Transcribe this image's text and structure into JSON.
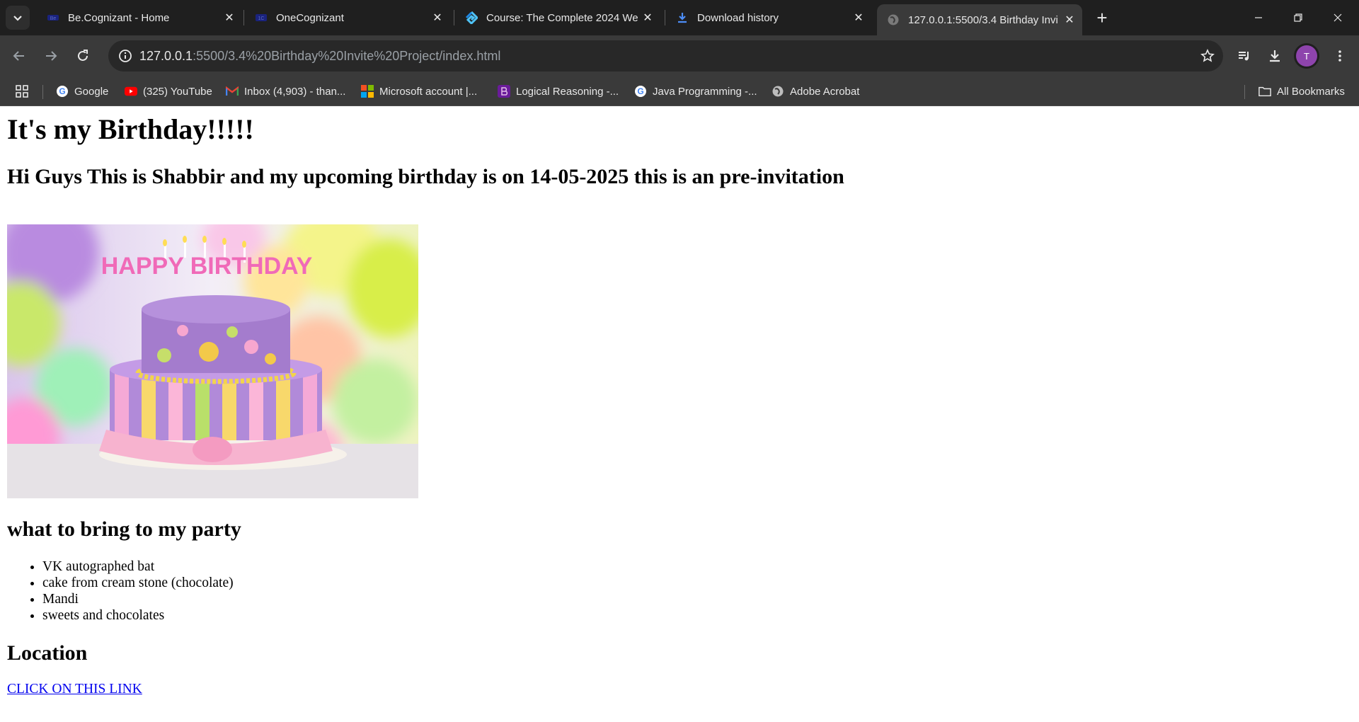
{
  "browser": {
    "tabs": [
      {
        "title": "Be.Cognizant - Home",
        "icon": "cognizant-favicon"
      },
      {
        "title": "OneCognizant",
        "icon": "onecognizant-favicon"
      },
      {
        "title": "Course: The Complete 2024 We",
        "icon": "udemy-favicon"
      },
      {
        "title": "Download history",
        "icon": "download-icon"
      },
      {
        "title": "127.0.0.1:5500/3.4 Birthday Invi",
        "icon": "globe-icon",
        "active": true
      }
    ],
    "address": {
      "host": "127.0.0.1",
      "path": ":5500/3.4%20Birthday%20Invite%20Project/index.html"
    },
    "profile_initial": "T",
    "bookmarks": [
      {
        "label": "Google",
        "icon": "google-icon"
      },
      {
        "label": "(325) YouTube",
        "icon": "youtube-icon"
      },
      {
        "label": "Inbox (4,903) - than...",
        "icon": "gmail-icon"
      },
      {
        "label": "Microsoft account |...",
        "icon": "microsoft-icon"
      },
      {
        "label": "Logical Reasoning -...",
        "icon": "bookmark-app-icon"
      },
      {
        "label": "Java Programming -...",
        "icon": "google-icon"
      },
      {
        "label": "Adobe Acrobat",
        "icon": "globe-icon"
      }
    ],
    "all_bookmarks_label": "All Bookmarks"
  },
  "page": {
    "heading": "It's my Birthday!!!!!",
    "subheading": "Hi Guys This is Shabbir and my upcoming birthday is on 14-05-2025 this is an pre-invitation",
    "image_text": "HAPPY BIRTHDAY",
    "bring_heading": "what to bring to my party",
    "bring_items": [
      "VK autographed bat",
      "cake from cream stone (chocolate)",
      "Mandi",
      "sweets and chocolates"
    ],
    "location_heading": "Location",
    "link_text": "CLICK ON THIS LINK"
  },
  "colors": {
    "tabstrip_bg": "#1f1f1f",
    "toolbar_bg": "#3a3a3a",
    "omnibox_bg": "#282828",
    "link": "#0000ee",
    "profile": "#8e44ad"
  }
}
